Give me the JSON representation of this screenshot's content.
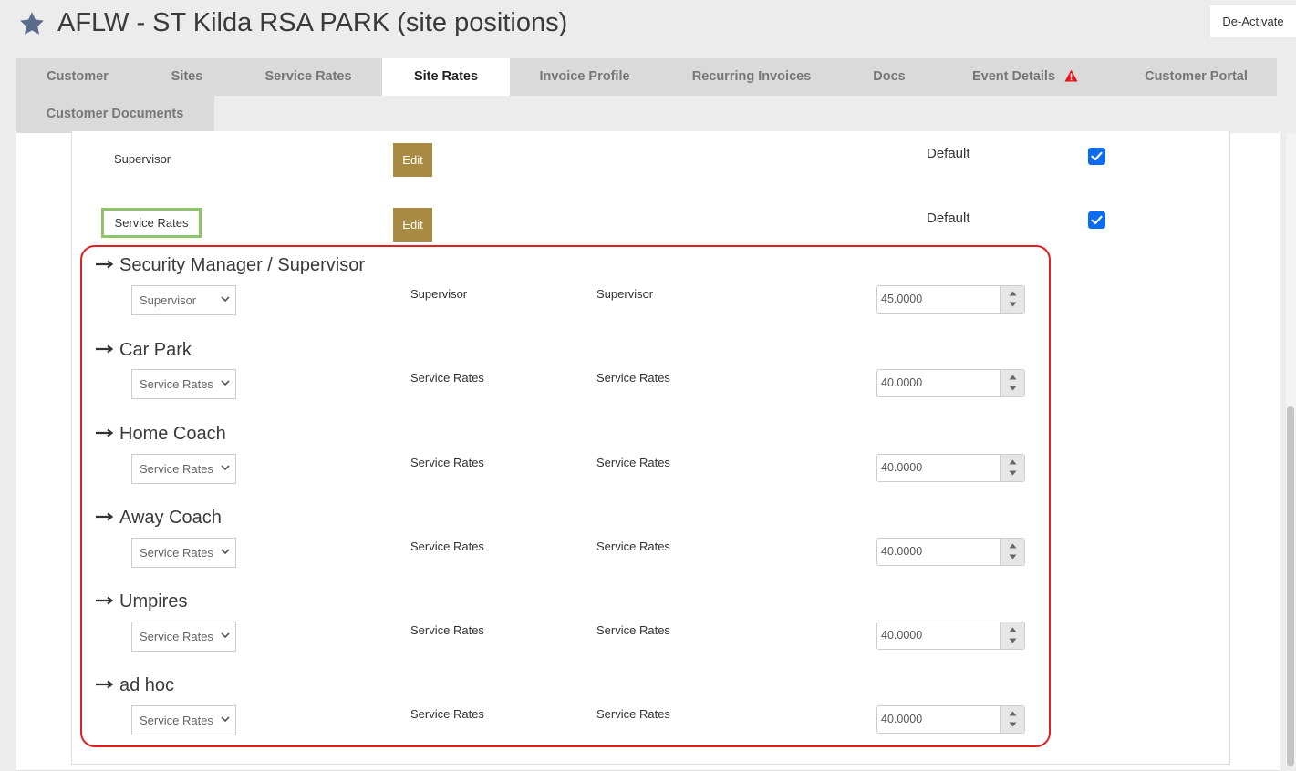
{
  "header": {
    "title": "AFLW - ST Kilda RSA PARK (site positions)",
    "icon": "star-icon",
    "deactivate_label": "De-Activate"
  },
  "tabs": [
    {
      "label": "Customer",
      "active": false
    },
    {
      "label": "Sites",
      "active": false
    },
    {
      "label": "Service Rates",
      "active": false
    },
    {
      "label": "Site Rates",
      "active": true
    },
    {
      "label": "Invoice Profile",
      "active": false
    },
    {
      "label": "Recurring Invoices",
      "active": false
    },
    {
      "label": "Docs",
      "active": false
    },
    {
      "label": "Event Details",
      "active": false,
      "icon": "warning-icon"
    },
    {
      "label": "Customer Portal",
      "active": false
    },
    {
      "label": "Customer Documents",
      "active": false
    }
  ],
  "rate_rows": [
    {
      "label": "Supervisor",
      "edit_label": "Edit",
      "default_label": "Default",
      "checked": true
    },
    {
      "label": "Service Rates",
      "edit_label": "Edit",
      "default_label": "Default",
      "checked": true
    }
  ],
  "positions": [
    {
      "title": "Security Manager / Supervisor",
      "select": "Supervisor",
      "col1": "Supervisor",
      "col2": "Supervisor",
      "rate": "45.0000"
    },
    {
      "title": "Car Park",
      "select": "Service Rates",
      "col1": "Service Rates",
      "col2": "Service Rates",
      "rate": "40.0000"
    },
    {
      "title": "Home Coach",
      "select": "Service Rates",
      "col1": "Service Rates",
      "col2": "Service Rates",
      "rate": "40.0000"
    },
    {
      "title": "Away Coach",
      "select": "Service Rates",
      "col1": "Service Rates",
      "col2": "Service Rates",
      "rate": "40.0000"
    },
    {
      "title": "Umpires",
      "select": "Service Rates",
      "col1": "Service Rates",
      "col2": "Service Rates",
      "rate": "40.0000"
    },
    {
      "title": "ad hoc",
      "select": "Service Rates",
      "col1": "Service Rates",
      "col2": "Service Rates",
      "rate": "40.0000"
    }
  ],
  "colors": {
    "accent_edit": "#a88a43",
    "highlight_red": "#e0201f",
    "highlight_green": "#8cc46a",
    "checkbox_blue": "#0b6cf0",
    "warning_red": "#e3141b"
  }
}
